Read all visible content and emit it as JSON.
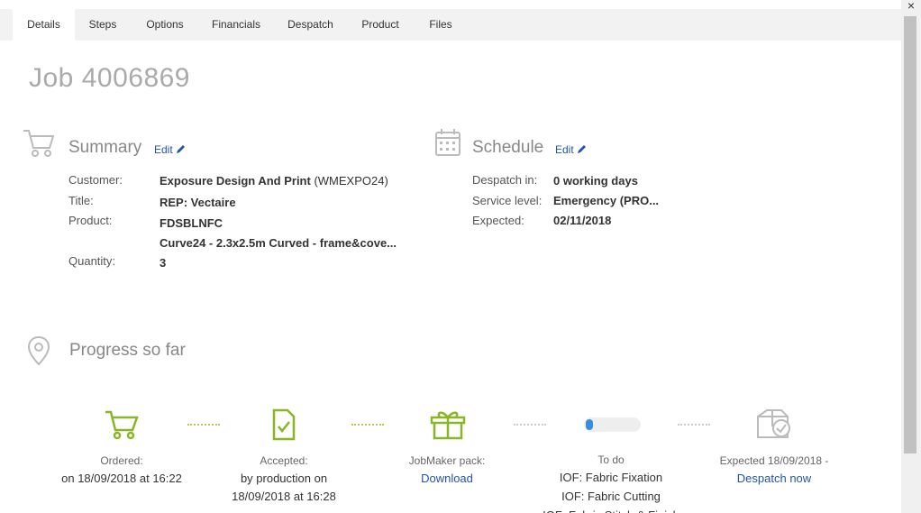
{
  "tabs": [
    "Details",
    "Steps",
    "Options",
    "Financials",
    "Despatch",
    "Product",
    "Files"
  ],
  "job_title": "Job 4006869",
  "summary": {
    "title": "Summary",
    "edit_label": "Edit",
    "customer_label": "Customer:",
    "customer_name": "Exposure Design And Print",
    "customer_code": " (WMEXPO24)",
    "title_label": "Title:",
    "title_value": "REP: Vectaire",
    "product_label": "Product:",
    "product_code": "FDSBLNFC",
    "product_desc": "Curve24 - 2.3x2.5m Curved - frame&cove...",
    "quantity_label": "Quantity:",
    "quantity_value": "3"
  },
  "schedule": {
    "title": "Schedule",
    "edit_label": "Edit",
    "despatch_label": "Despatch in:",
    "despatch_value": "0 working days",
    "service_label": "Service level:",
    "service_value": "Emergency (PRO...",
    "expected_label": "Expected:",
    "expected_value": "02/11/2018"
  },
  "progress": {
    "title": "Progress so far",
    "ordered_label": "Ordered:",
    "ordered_text": "on 18/09/2018 at 16:22",
    "accepted_label": "Accepted:",
    "accepted_line1": "by production on",
    "accepted_line2": "18/09/2018 at 16:28",
    "pack_label": "JobMaker pack:",
    "pack_link": "Download",
    "todo_label": "To do",
    "todo_items": [
      "IOF: Fabric Fixation",
      "IOF: Fabric Cutting",
      "IOF: Fabric Stitch & Finish"
    ],
    "todo_progress": 0.12,
    "expected_label": "Expected 18/09/2018 -",
    "expected_link": "Despatch now"
  },
  "colors": {
    "accent_green": "#8ab626",
    "link_blue": "#2255aa",
    "progress_blue": "#3a8dde"
  },
  "close_label": "×"
}
